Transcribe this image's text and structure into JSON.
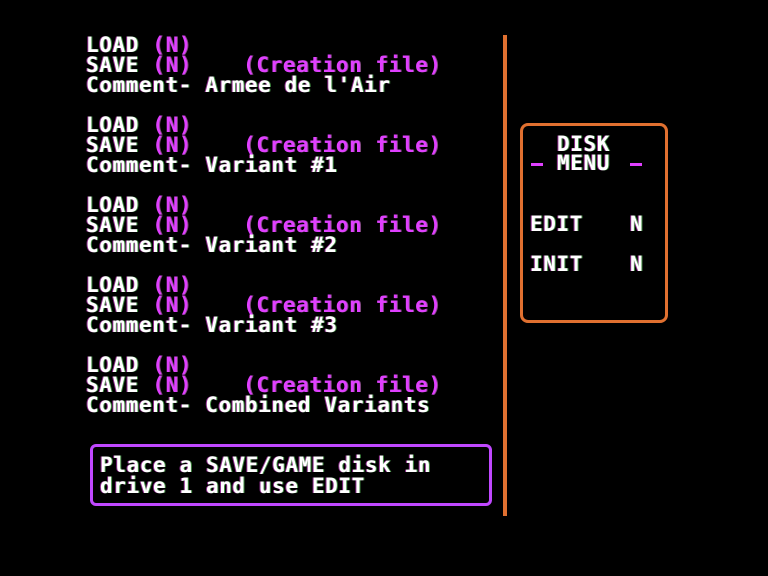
{
  "entries": [
    {
      "load_label": "LOAD",
      "load_val": "(N)",
      "save_label": "SAVE",
      "save_val": "(N)",
      "file_type": "(Creation file)",
      "comment_label": "Comment-",
      "comment": "Armee de l'Air"
    },
    {
      "load_label": "LOAD",
      "load_val": "(N)",
      "save_label": "SAVE",
      "save_val": "(N)",
      "file_type": "(Creation file)",
      "comment_label": "Comment-",
      "comment": "Variant #1"
    },
    {
      "load_label": "LOAD",
      "load_val": "(N)",
      "save_label": "SAVE",
      "save_val": "(N)",
      "file_type": "(Creation file)",
      "comment_label": "Comment-",
      "comment": "Variant #2"
    },
    {
      "load_label": "LOAD",
      "load_val": "(N)",
      "save_label": "SAVE",
      "save_val": "(N)",
      "file_type": "(Creation file)",
      "comment_label": "Comment-",
      "comment": "Variant #3"
    },
    {
      "load_label": "LOAD",
      "load_val": "(N)",
      "save_label": "SAVE",
      "save_val": "(N)",
      "file_type": "(Creation file)",
      "comment_label": "Comment-",
      "comment": "Combined Variants"
    }
  ],
  "disk_menu": {
    "title1": "DISK",
    "title2": "MENU",
    "edit_label": "EDIT",
    "edit_val": "N",
    "init_label": "INIT",
    "init_val": "N"
  },
  "message": {
    "line1": "Place a SAVE/GAME disk in",
    "line2": "drive 1 and use EDIT"
  },
  "colors": {
    "text": "#ffffff",
    "accent_magenta": "#e040ff",
    "border_orange": "#e07030",
    "border_purple": "#c048ff",
    "background": "#000000"
  }
}
